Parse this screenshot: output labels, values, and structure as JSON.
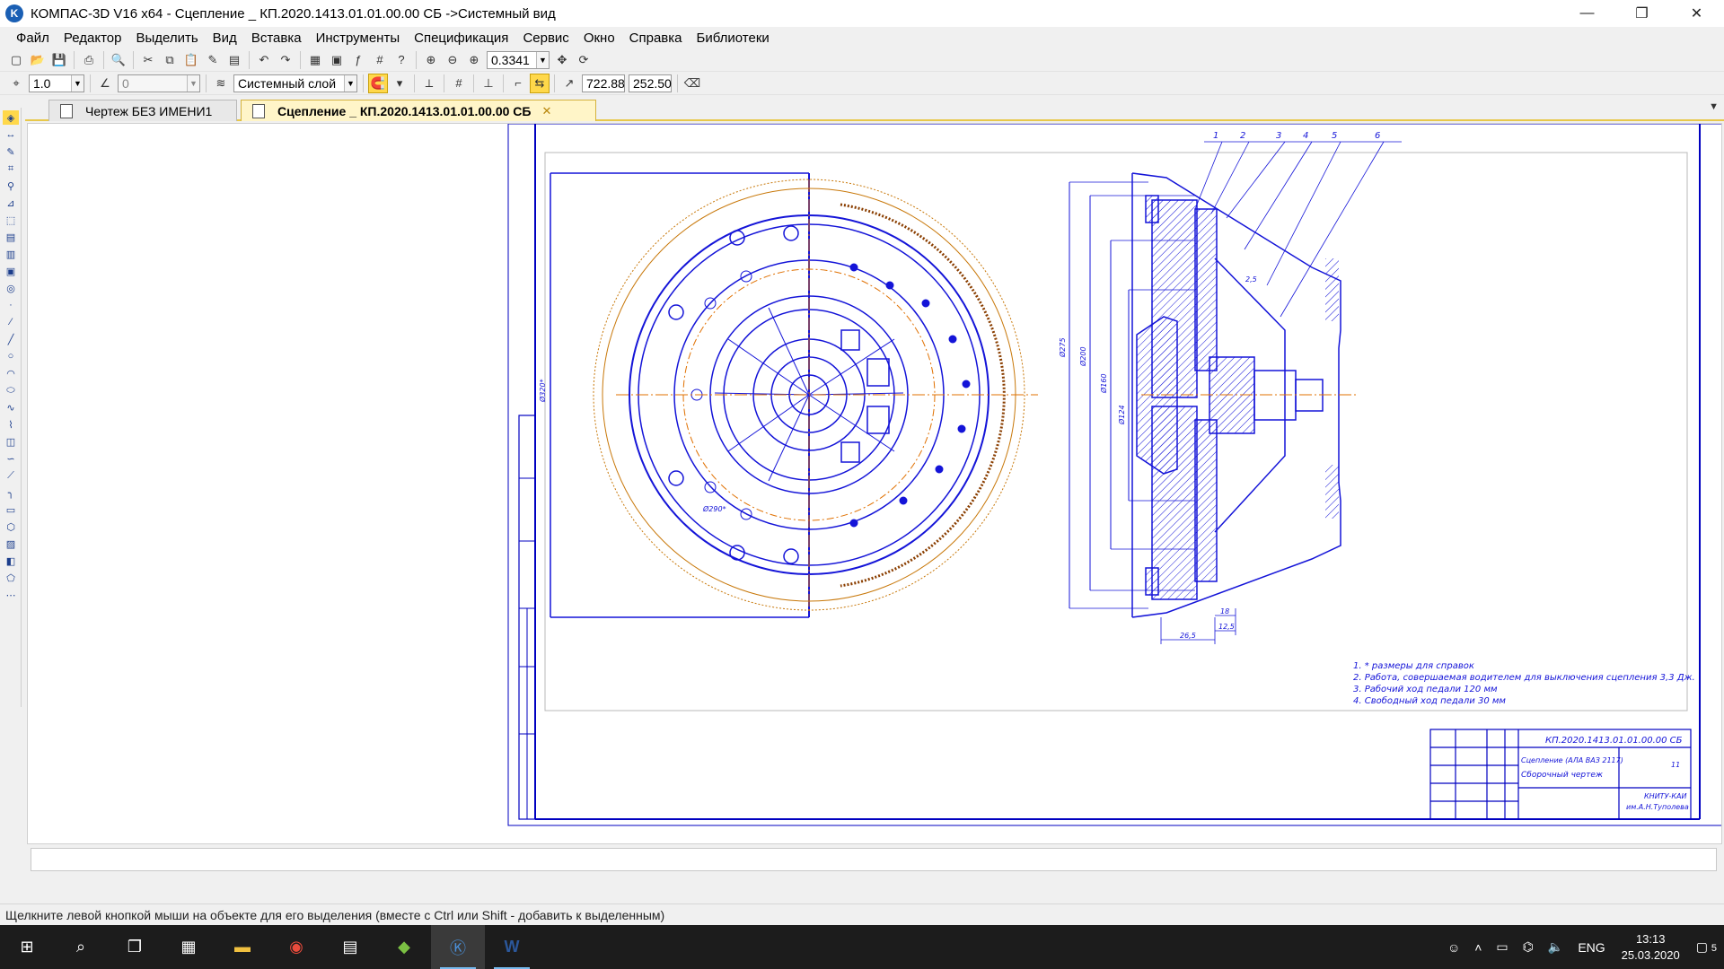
{
  "window": {
    "title": "КОМПАС-3D V16  x64 - Сцепление _ КП.2020.1413.01.01.00.00 СБ ->Системный вид",
    "app_icon": "kompas-logo-icon",
    "min": "—",
    "max": "❐",
    "close": "✕"
  },
  "menu": [
    "Файл",
    "Редактор",
    "Выделить",
    "Вид",
    "Вставка",
    "Инструменты",
    "Спецификация",
    "Сервис",
    "Окно",
    "Справка",
    "Библиотеки"
  ],
  "toolbar": {
    "zoom_value": "0.3341",
    "step_value": "1.0",
    "angle_value": "0",
    "layer_value": "Системный слой",
    "coord_x": "722.88",
    "coord_y": "252.50"
  },
  "tabs": [
    {
      "label": "Чертеж БЕЗ ИМЕНИ1",
      "active": false
    },
    {
      "label": "Сцепление _ КП.2020.1413.01.01.00.00 СБ",
      "active": true
    }
  ],
  "drawing": {
    "notes": [
      "1. * размеры для справок",
      "2. Работа, совершаемая водителем для выключения сцепления 3,3 Дж.",
      "3. Рабочий ход педали 120 мм",
      "4. Свободный ход педали 30 мм"
    ],
    "stamp": {
      "designation": "КП.2020.1413.01.01.00.00 СБ",
      "name_1": "Сцепление (АЛА ВАЗ 2117)",
      "name_2": "Сборочный чертеж",
      "org_1": "КНИТУ-КАИ",
      "org_2": "им.А.Н.Туполева",
      "sheets": "11"
    },
    "leaders": [
      "1",
      "2",
      "3",
      "4",
      "5",
      "6"
    ],
    "dims": {
      "d320": "Ø320*",
      "d290": "Ø290*",
      "d275": "Ø275",
      "d200": "Ø200",
      "d160": "Ø160",
      "d124": "Ø124",
      "d18": "18",
      "d265": "26,5",
      "d125": "12,5",
      "d25": "2,5"
    }
  },
  "status": {
    "hint": "Щелкните левой кнопкой мыши на объекте для его выделения (вместе с Ctrl или Shift - добавить к выделенным)"
  },
  "taskbar": {
    "lang": "ENG",
    "time": "13:13",
    "date": "25.03.2020",
    "notif_count": "5"
  },
  "colors": {
    "drawing_blue": "#1414d8",
    "axis_orange": "#e07000",
    "frame": "#0000c0",
    "tab_active": "#fff5c8"
  }
}
